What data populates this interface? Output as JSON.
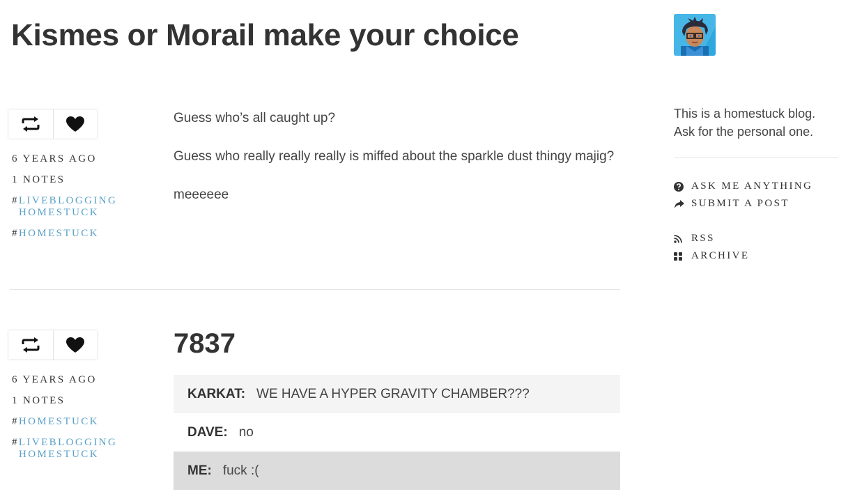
{
  "blog": {
    "title": "Kismes or Morail make your choice",
    "description": "This is a homestuck blog. Ask for the personal one."
  },
  "posts": [
    {
      "time": "6 YEARS AGO",
      "notes": "1 NOTES",
      "tags": [
        "LIVEBLOGGING HOMESTUCK",
        "HOMESTUCK"
      ],
      "paragraphs": [
        "Guess who’s all caught up?",
        "Guess who really really really is miffed about the sparkle dust thingy majig?",
        "meeeeee"
      ]
    },
    {
      "time": "6 YEARS AGO",
      "notes": "1 NOTES",
      "tags": [
        "HOMESTUCK",
        "LIVEBLOGGING HOMESTUCK"
      ],
      "title": "7837",
      "chat": [
        {
          "speaker": "KARKAT:",
          "text": "WE HAVE A HYPER GRAVITY CHAMBER???"
        },
        {
          "speaker": "DAVE:",
          "text": "no"
        },
        {
          "speaker": "ME:",
          "text": "fuck :("
        }
      ]
    }
  ],
  "sidebar": {
    "links": [
      {
        "label": "ASK ME ANYTHING",
        "icon": "question-circle-icon"
      },
      {
        "label": "SUBMIT A POST",
        "icon": "share-arrow-icon"
      },
      {
        "label": "RSS",
        "icon": "rss-icon"
      },
      {
        "label": "ARCHIVE",
        "icon": "archive-grid-icon"
      }
    ]
  },
  "tag_hash": "#",
  "colors": {
    "tag_link": "#5aa0c8",
    "text": "#444444",
    "heading": "#333333",
    "avatar_bg": "#2fa8e0"
  }
}
